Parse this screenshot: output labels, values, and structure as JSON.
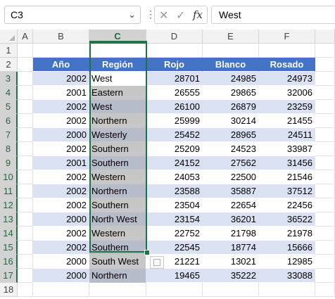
{
  "formula_bar": {
    "name_box": "C3",
    "fx_label": "fx",
    "value": "West"
  },
  "columns": [
    "A",
    "B",
    "C",
    "D",
    "E",
    "F"
  ],
  "rows": [
    "1",
    "2",
    "3",
    "4",
    "5",
    "6",
    "7",
    "8",
    "9",
    "10",
    "11",
    "12",
    "13",
    "14",
    "15",
    "16",
    "17",
    "18"
  ],
  "table": {
    "headers": [
      "Año",
      "Región",
      "Rojo",
      "Blanco",
      "Rosado"
    ],
    "rows": [
      [
        "2002",
        "West",
        "28701",
        "24985",
        "24973"
      ],
      [
        "2001",
        "Eastern",
        "26555",
        "29865",
        "32006"
      ],
      [
        "2002",
        "West",
        "26100",
        "26879",
        "23259"
      ],
      [
        "2002",
        "Northern",
        "25999",
        "30214",
        "21455"
      ],
      [
        "2000",
        "Westerly",
        "25452",
        "28965",
        "24511"
      ],
      [
        "2002",
        "Southern",
        "25209",
        "24523",
        "33987"
      ],
      [
        "2001",
        "Southern",
        "24152",
        "27562",
        "31456"
      ],
      [
        "2002",
        "Western",
        "24053",
        "22500",
        "21546"
      ],
      [
        "2002",
        "Northern",
        "23588",
        "35887",
        "37512"
      ],
      [
        "2002",
        "Southern",
        "23504",
        "22654",
        "22456"
      ],
      [
        "2000",
        "North West",
        "23154",
        "36201",
        "36522"
      ],
      [
        "2002",
        "Western",
        "22752",
        "21798",
        "21978"
      ],
      [
        "2002",
        "Southern",
        "22545",
        "18774",
        "15666"
      ],
      [
        "2000",
        "South West",
        "21221",
        "13021",
        "12985"
      ],
      [
        "2000",
        "Northern",
        "19465",
        "35222",
        "33088"
      ]
    ]
  },
  "selection": {
    "active_cell": "C3",
    "range": "C3:C17"
  },
  "colors": {
    "header_fill": "#4472c4",
    "band_fill": "#d9e1f2",
    "selection_border": "#217346"
  }
}
